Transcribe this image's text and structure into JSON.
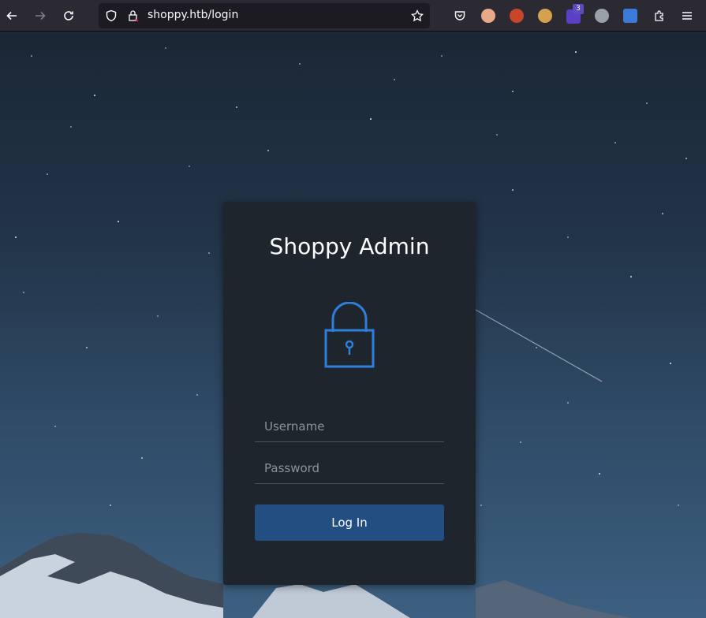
{
  "browser": {
    "url": "shoppy.htb/login",
    "extension_badge": "3",
    "icons": [
      "back-icon",
      "forward-icon",
      "reload-icon",
      "shield-icon",
      "site-security-icon",
      "bookmark-star-icon",
      "pocket-icon",
      "extension-icons",
      "extensions-puzzle-icon",
      "menu-icon"
    ]
  },
  "login": {
    "title": "Shoppy Admin",
    "username_placeholder": "Username",
    "password_placeholder": "Password",
    "submit_label": "Log In",
    "lock_color": "#2d7fdb"
  },
  "colors": {
    "card_bg": "#1e252d",
    "button_bg": "#234e82"
  }
}
